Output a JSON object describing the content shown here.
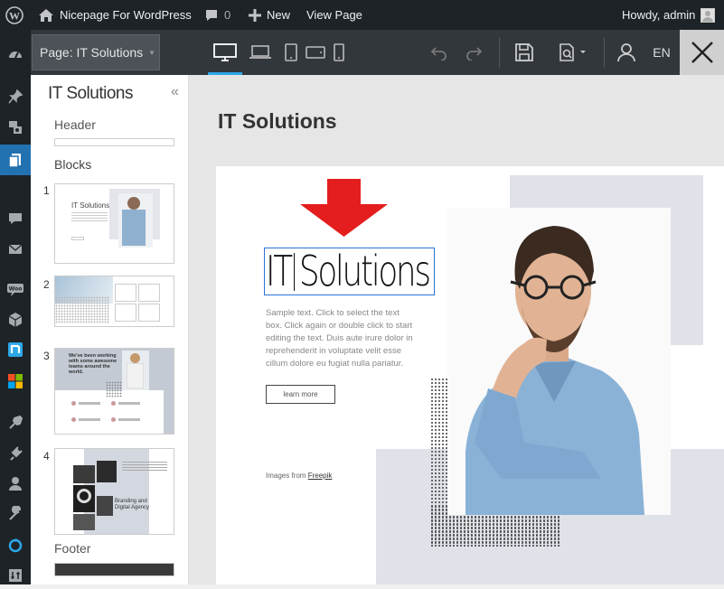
{
  "adminbar": {
    "site_name": "Nicepage For WordPress",
    "comments_count": "0",
    "new_label": "New",
    "view_page": "View Page",
    "howdy": "Howdy, admin"
  },
  "toolbar": {
    "page_select": "Page: IT Solutions",
    "lang": "EN"
  },
  "panel": {
    "title": "IT Solutions",
    "header_label": "Header",
    "blocks_label": "Blocks",
    "footer_label": "Footer",
    "blocks": [
      {
        "num": "1",
        "title": "IT Solutions"
      },
      {
        "num": "2"
      },
      {
        "num": "3",
        "heading": "We've been working with some awesome teams around the world."
      },
      {
        "num": "4",
        "title": "Branding and Digital Agency"
      }
    ]
  },
  "canvas": {
    "page_title": "IT Solutions",
    "block_heading": "IT Solutions",
    "sample_text": "Sample text. Click to select the text box. Click again or double click to start editing the text. Duis aute irure dolor in reprehenderit in voluptate velit esse cillum dolore eu fugiat nulla pariatur.",
    "button": "learn more",
    "credit_prefix": "Images from",
    "credit_link": "Freepik"
  },
  "colors": {
    "adminbar_bg": "#1d2327",
    "toolbar_bg": "#32373c",
    "accent_blue": "#2271b1",
    "arrow_red": "#e41e1e",
    "deco_gray": "#dfe2e8",
    "select_border": "#2b72d6"
  }
}
